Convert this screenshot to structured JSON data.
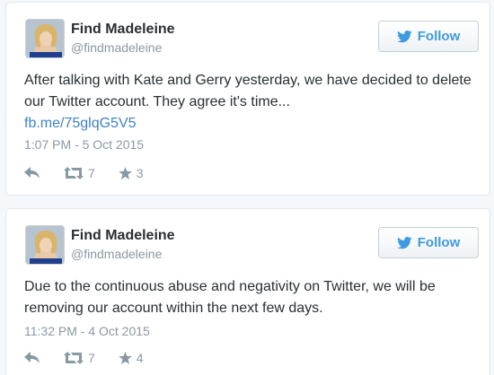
{
  "tweets": [
    {
      "author_name": "Find Madeleine",
      "handle": "@findmadeleine",
      "follow_label": "Follow",
      "text": "After talking with Kate and Gerry yesterday, we have decided to delete our Twitter account. They agree it's time...",
      "link": "fb.me/75glqG5V5",
      "timestamp": "1:07 PM - 5 Oct 2015",
      "retweets": "7",
      "favorites": "3"
    },
    {
      "author_name": "Find Madeleine",
      "handle": "@findmadeleine",
      "follow_label": "Follow",
      "text": "Due to the continuous abuse and negativity on Twitter, we will be removing our account within the next few days.",
      "timestamp": "11:32 PM - 4 Oct 2015",
      "retweets": "7",
      "favorites": "4"
    }
  ],
  "icons": {
    "follow": "twitter-bird-icon",
    "reply": "reply-icon",
    "retweet": "retweet-icon",
    "favorite": "star-icon"
  },
  "colors": {
    "accent": "#3f9ae0",
    "link": "#3f82c4",
    "muted": "#8899a6",
    "text": "#292f33",
    "card_border": "#e1e8ed"
  }
}
